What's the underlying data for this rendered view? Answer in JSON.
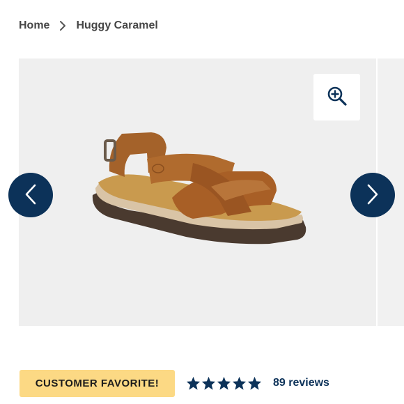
{
  "breadcrumb": {
    "home": "Home",
    "current": "Huggy Caramel"
  },
  "gallery": {
    "image_alt": "Huggy Caramel sandal",
    "zoom_icon": "zoom-in-icon",
    "prev_icon": "chevron-left-icon",
    "next_icon": "chevron-right-icon"
  },
  "badge": {
    "label": "CUSTOMER FAVORITE!"
  },
  "rating": {
    "stars": 5,
    "reviews_label": "89 reviews"
  },
  "colors": {
    "brand_navy": "#0c3259",
    "badge_yellow": "#fcd984",
    "gallery_bg": "#efefef"
  }
}
